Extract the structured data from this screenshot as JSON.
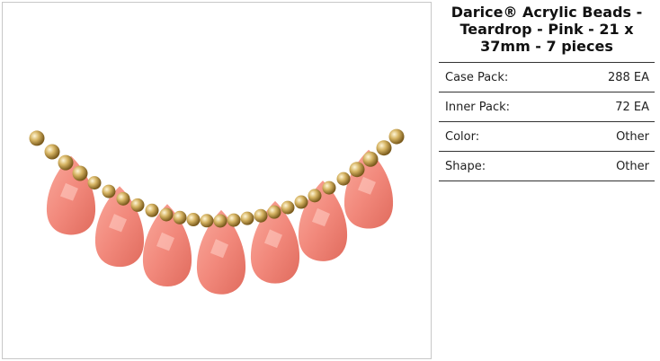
{
  "product": {
    "title": "Darice® Acrylic Beads - Teardrop - Pink - 21 x 37mm - 7 pieces",
    "image_alt": "product-photo",
    "colors": {
      "bead_pink": "#f2897c",
      "bead_gold": "#c9a24a",
      "border": "#c8c8c8",
      "divider": "#333333"
    }
  },
  "specs": [
    {
      "label": "Case Pack:",
      "value": "288 EA"
    },
    {
      "label": "Inner Pack:",
      "value": "72 EA"
    },
    {
      "label": "Color:",
      "value": "Other"
    },
    {
      "label": "Shape:",
      "value": "Other"
    }
  ]
}
